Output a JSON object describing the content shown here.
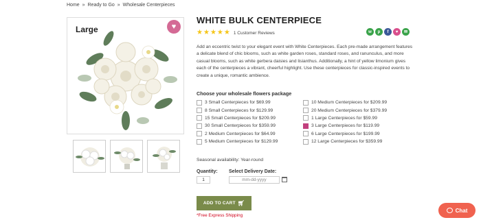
{
  "breadcrumb": {
    "home": "Home",
    "level2": "Ready to Go",
    "current": "Wholesale Centerpieces",
    "separator": "»"
  },
  "product": {
    "size_label": "Large",
    "title": "WHITE BULK CENTERPIECE",
    "rating_stars": 5,
    "reviews": "1 Customer Reviews",
    "description": "Add an eccentric twist to your elegant event with White Centerpieces. Each pre-made arrangement features a delicate blend of chic blooms, such as white garden roses, standard roses, and ranunculus, and more casual blooms, such as white gerbera daisies and lisianthus. Additionally, a hint of yellow limonium gives each of the centerpieces a vibrant, cheerful highlight. Use these centerpieces for classic-inspired events to create a unique, romantic ambience.",
    "package_title": "Choose your wholesale flowers package",
    "packages_left": [
      {
        "label": "3 Small Centerpieces for $69.99",
        "checked": false
      },
      {
        "label": "8 Small Centerpieces for $129.99",
        "checked": false
      },
      {
        "label": "15 Small Centerpieces for $209.99",
        "checked": false
      },
      {
        "label": "30 Small Centerpieces for $359.99",
        "checked": false
      },
      {
        "label": "2 Medium Centerpieces for $64.99",
        "checked": false
      },
      {
        "label": "5 Medium Centerpieces for $129.99",
        "checked": false
      }
    ],
    "packages_right": [
      {
        "label": "10 Medium Centerpieces for $209.99",
        "checked": false
      },
      {
        "label": "20 Medium Centerpieces for $379.99",
        "checked": false
      },
      {
        "label": "1 Large Centerpieces for $59.99",
        "checked": false
      },
      {
        "label": "3 Large Centerpieces for $119.99",
        "checked": true
      },
      {
        "label": "6 Large Centerpieces for $199.99",
        "checked": false
      },
      {
        "label": "12 Large Centerpieces for $359.99",
        "checked": false
      }
    ],
    "seasonal": "Seasonal availability: Year-round",
    "quantity_label": "Quantity:",
    "quantity_value": "1",
    "date_label": "Select Delivery Date:",
    "date_placeholder": "mm-dd-yyyy",
    "add_to_cart": "ADD TO CART",
    "shipping_note": "*Free Express Shipping"
  },
  "chat": {
    "label": "Chat"
  },
  "colors": {
    "accent_pink": "#d46a95",
    "button_green": "#7a8b4a",
    "chat_coral": "#f0624f",
    "star": "#f5c518",
    "share_green": "#3aa34a",
    "share_pink": "#d94f8c",
    "share_blue": "#3b5998"
  },
  "share_icons": [
    "whatsapp-icon",
    "pinterest-icon",
    "facebook-icon",
    "heart-icon",
    "email-icon"
  ]
}
